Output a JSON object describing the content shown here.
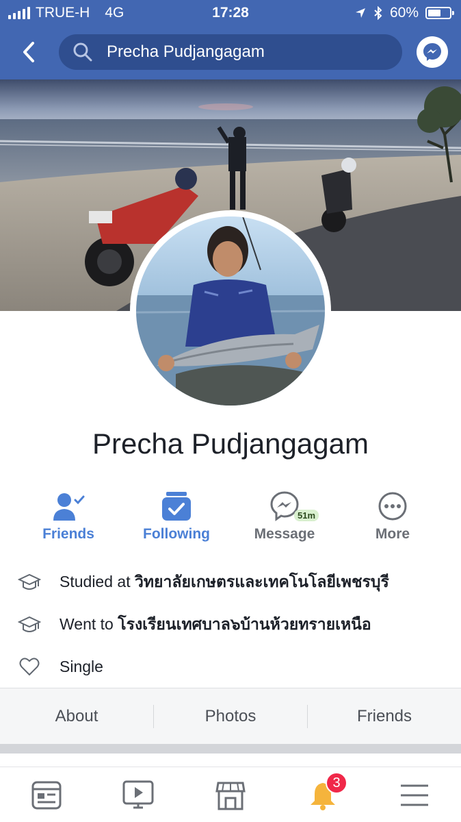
{
  "status_bar": {
    "carrier": "TRUE-H",
    "network": "4G",
    "time": "17:28",
    "battery": "60%",
    "battery_level": 0.6
  },
  "header": {
    "search_text": "Precha Pudjangagam"
  },
  "profile": {
    "name": "Precha Pudjangagam"
  },
  "actions": {
    "friends": "Friends",
    "following": "Following",
    "message": "Message",
    "message_badge": "51m",
    "more": "More"
  },
  "intro": {
    "studied_prefix": "Studied at ",
    "studied_place": "วิทยาลัยเกษตรและเทคโนโลยีเพชรบุรี",
    "went_prefix": "Went to ",
    "went_place": "โรงเรียนเทศบาล๖บ้านห้วยทรายเหนือ",
    "relationship": "Single"
  },
  "tabs": {
    "about": "About",
    "photos": "Photos",
    "friends": "Friends"
  },
  "bottom_nav": {
    "notifications_count": "3"
  },
  "colors": {
    "brand_blue": "#4267b2",
    "accent_blue": "#4b80d6",
    "badge_red": "#f02849"
  }
}
